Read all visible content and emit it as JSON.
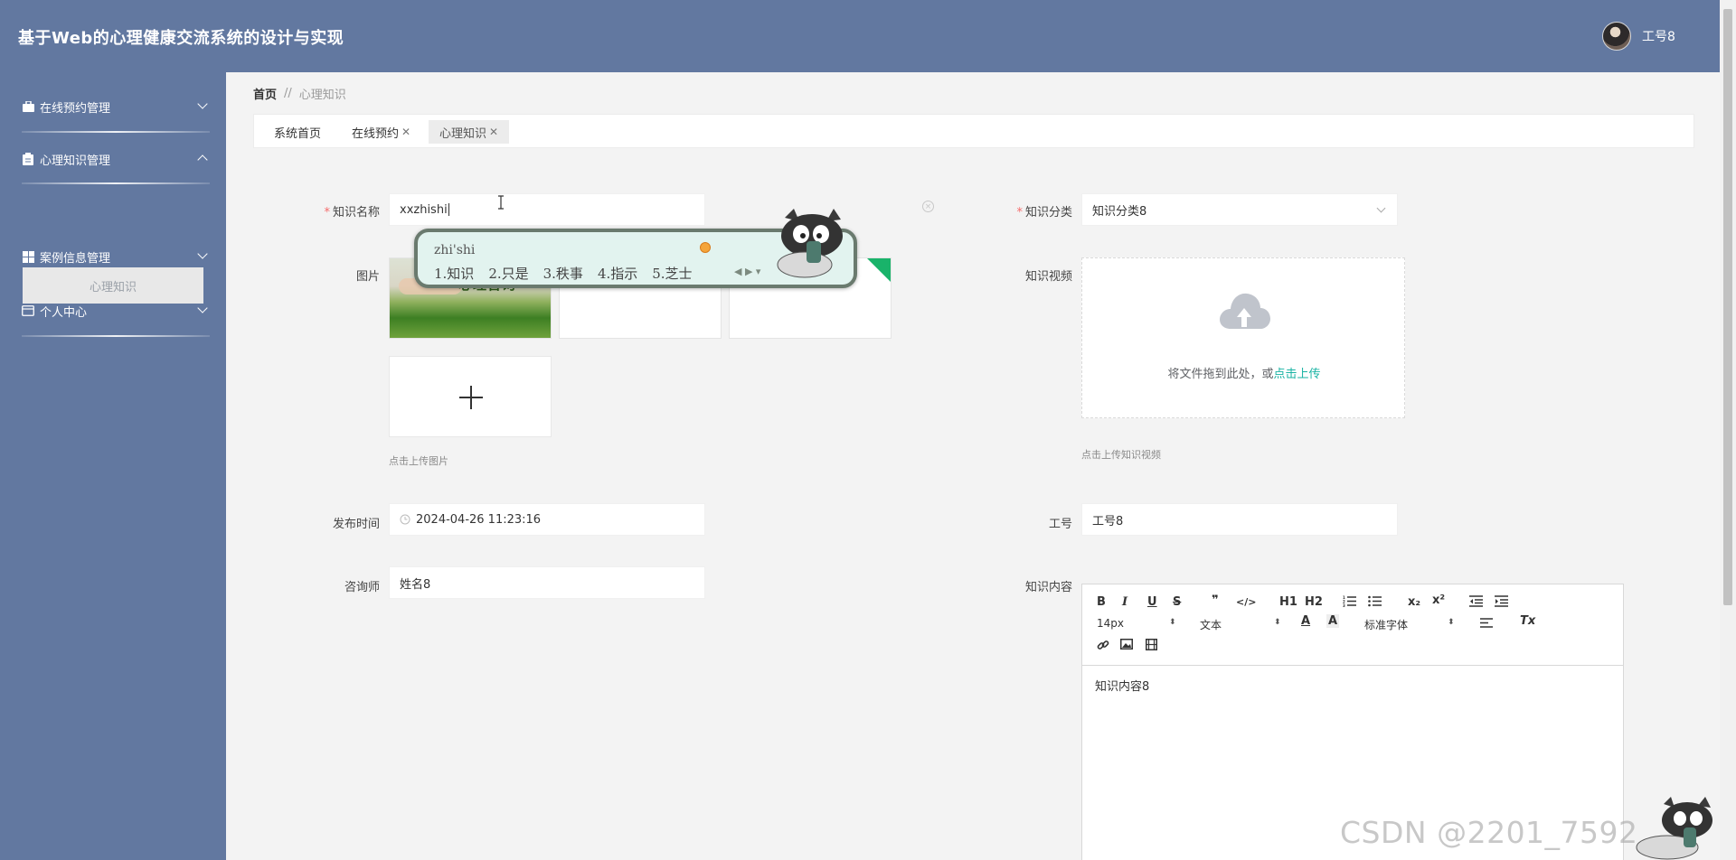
{
  "app": {
    "title": "基于Web的心理健康交流系统的设计与实现"
  },
  "user": {
    "name": "工号8"
  },
  "sidebar": {
    "items": [
      {
        "label": "在线预约管理",
        "icon": "briefcase-icon",
        "expanded": false
      },
      {
        "label": "心理知识管理",
        "icon": "clipboard-icon",
        "expanded": true,
        "children": [
          {
            "label": "心理知识"
          }
        ]
      },
      {
        "label": "案例信息管理",
        "icon": "grid-icon",
        "expanded": false
      },
      {
        "label": "个人中心",
        "icon": "id-card-icon",
        "expanded": false
      }
    ]
  },
  "breadcrumb": {
    "home": "首页",
    "separator": "//",
    "current": "心理知识"
  },
  "tabs": [
    {
      "label": "系统首页",
      "closable": false,
      "active": false
    },
    {
      "label": "在线预约",
      "closable": true,
      "active": false
    },
    {
      "label": "心理知识",
      "closable": true,
      "active": true
    }
  ],
  "form": {
    "knowledge_name": {
      "label": "知识名称",
      "value": "xxzhishi",
      "required": true
    },
    "knowledge_category": {
      "label": "知识分类",
      "value": "知识分类8",
      "required": true
    },
    "image": {
      "label": "图片",
      "hint": "点击上传图片",
      "image_caption": "心理咨询"
    },
    "video": {
      "label": "知识视频",
      "drop_text": "将文件拖到此处，或",
      "drop_link": "点击上传",
      "hint": "点击上传知识视频"
    },
    "publish_time": {
      "label": "发布时间",
      "value": "2024-04-26 11:23:16"
    },
    "job_no": {
      "label": "工号",
      "value": "工号8"
    },
    "counselor": {
      "label": "咨询师",
      "value": "姓名8"
    },
    "content": {
      "label": "知识内容",
      "value": "知识内容8"
    }
  },
  "editor_toolbar": {
    "font_size": "14px",
    "header": "文本",
    "font_family": "标准字体",
    "buttons": [
      "B",
      "I",
      "U",
      "S",
      "❞",
      "</>",
      "H1",
      "H2",
      "ordered-list",
      "bullet-list",
      "x₂",
      "x²",
      "outdent",
      "indent",
      "A",
      "A",
      "align",
      "Tx",
      "link",
      "image",
      "video"
    ]
  },
  "ime": {
    "composition": "zhi'shi",
    "candidates": [
      "1.知识",
      "2.只是",
      "3.秩事",
      "4.指示",
      "5.芝士"
    ]
  },
  "watermark": "CSDN @2201_7592",
  "colors": {
    "primary": "#6278a0",
    "accent": "#19b3a3",
    "required": "#f56c6c",
    "background": "#f3f3f3"
  }
}
